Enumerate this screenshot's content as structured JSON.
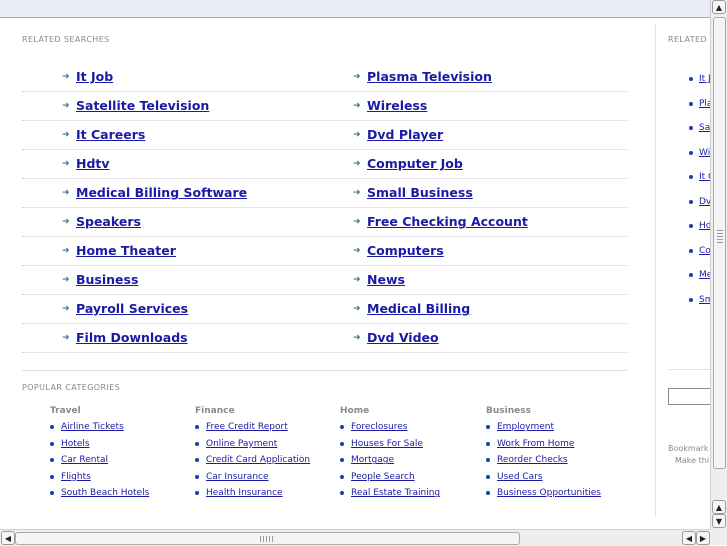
{
  "related": {
    "heading": "RELATED SEARCHES",
    "rows": [
      [
        "It Job",
        "Plasma Television"
      ],
      [
        "Satellite Television",
        "Wireless"
      ],
      [
        "It Careers",
        "Dvd Player"
      ],
      [
        "Hdtv",
        "Computer Job"
      ],
      [
        "Medical Billing Software",
        "Small Business"
      ],
      [
        "Speakers",
        "Free Checking Account"
      ],
      [
        "Home Theater",
        "Computers"
      ],
      [
        "Business",
        "News"
      ],
      [
        "Payroll Services",
        "Medical Billing"
      ],
      [
        "Film Downloads",
        "Dvd Video"
      ]
    ],
    "arrow_icon": "➜"
  },
  "popular": {
    "heading": "POPULAR CATEGORIES",
    "categories": [
      {
        "title": "Travel",
        "links": [
          "Airline Tickets",
          "Hotels",
          "Car Rental",
          "Flights",
          "South Beach Hotels"
        ]
      },
      {
        "title": "Finance",
        "links": [
          "Free Credit Report",
          "Online Payment",
          "Credit Card Application",
          "Car Insurance",
          "Health Insurance"
        ]
      },
      {
        "title": "Home",
        "links": [
          "Foreclosures",
          "Houses For Sale",
          "Mortgage",
          "People Search",
          "Real Estate Training"
        ]
      },
      {
        "title": "Business",
        "links": [
          "Employment",
          "Work From Home",
          "Reorder Checks",
          "Used Cars",
          "Business Opportunities"
        ]
      }
    ]
  },
  "sidebar": {
    "heading": "RELATED",
    "links": [
      "It J",
      "Pla",
      "Sa",
      "Wi",
      "It C",
      "Dv",
      "Hd",
      "Co",
      "Me",
      "Sm"
    ],
    "bookmark_line1": "Bookmark",
    "bookmark_line2": "Make thi"
  },
  "scrollbars": {
    "up_arrow": "▲",
    "down_arrow": "▼",
    "left_arrow": "◀",
    "right_arrow": "▶"
  },
  "colors": {
    "link": "#1a1aa6",
    "arrow": "#3c7a86",
    "top_border": "#8fb2cf"
  }
}
